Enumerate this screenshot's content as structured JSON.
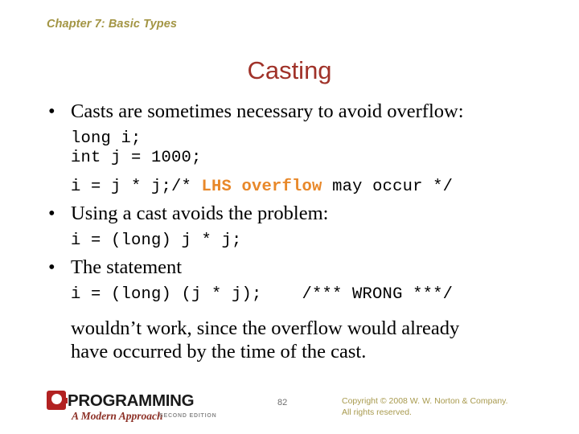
{
  "slide": {
    "chapter_header": "Chapter 7: Basic Types",
    "title": "Casting",
    "page_number": "82"
  },
  "content": {
    "bullet1": "Casts are sometimes necessary to avoid overflow:",
    "code1_line1": "long i;",
    "code1_line2": "int j = 1000;",
    "code2_prefix": "i = j * j;/* ",
    "code2_highlight": "LHS overflow",
    "code2_suffix": " may occur */",
    "bullet2": "Using a cast avoids the problem:",
    "code3": "i = (long) j * j;",
    "bullet3": "The statement",
    "code4": "i = (long) (j * j);    /*** WRONG ***/",
    "trailing1": "wouldn’t work, since the overflow would already",
    "trailing2": "have occurred by the time of the cast.",
    "bullet_glyph": "•"
  },
  "footer": {
    "logo_word": "PROGRAMMING",
    "logo_letter": "C",
    "logo_subtitle": "A Modern Approach",
    "logo_edition": "SECOND EDITION",
    "copyright_line1": "Copyright © 2008 W. W. Norton & Company.",
    "copyright_line2": "All rights reserved."
  },
  "colors": {
    "header_olive": "#a39544",
    "title_red": "#a03229",
    "highlight_orange": "#e8882a",
    "logo_red": "#b22222",
    "copyright_olive": "#a89a4e",
    "page_number_gray": "#6e6e6e"
  }
}
